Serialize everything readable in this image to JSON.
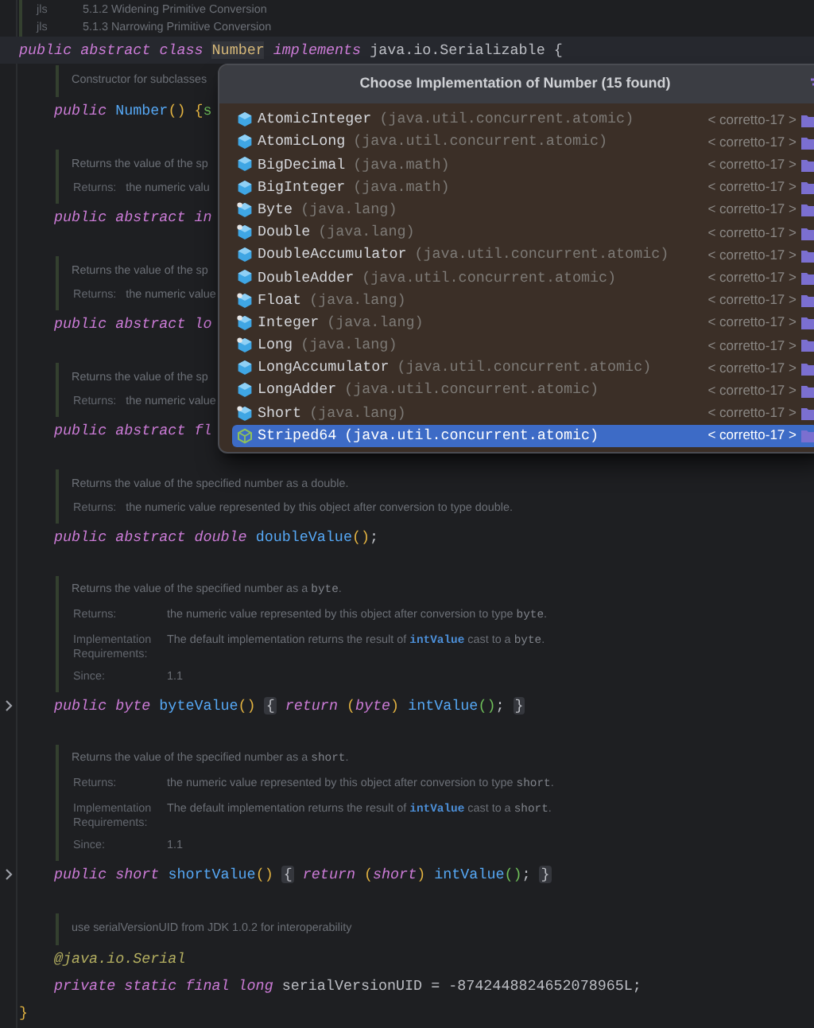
{
  "editor": {
    "class": {
      "doc": {
        "tags": [
          {
            "label": "jls",
            "text": [
              {
                "kind": "text",
                "text": "5.1.2 Widening Primitive Conversion"
              }
            ]
          },
          {
            "label": "jls",
            "text": [
              {
                "kind": "text",
                "text": "5.1.3 Narrowing Primitive Conversion"
              }
            ]
          }
        ]
      },
      "declaration": {
        "tokens": [
          {
            "kind": "keyword",
            "text": "public abstract class "
          },
          {
            "kind": "class_marked",
            "text": "Number"
          },
          {
            "kind": "keyword",
            "text": " implements "
          },
          {
            "kind": "plain",
            "text": "java.io.Serializable {"
          }
        ]
      },
      "members": [
        {
          "doc": {
            "summary": [
              {
                "kind": "text",
                "text": "Constructor for subclasses"
              }
            ]
          },
          "lines": [
            {
              "folded": false,
              "tokens": [
                {
                  "kind": "keyword",
                  "text": "public "
                },
                {
                  "kind": "method",
                  "text": "Number"
                },
                {
                  "kind": "bracket",
                  "text": "() {"
                },
                {
                  "kind": "bracket2",
                  "text": "s"
                }
              ]
            }
          ]
        },
        {
          "doc": {
            "summary": [
              {
                "kind": "text",
                "text": "Returns the value of the sp"
              }
            ],
            "tags": [
              {
                "label": "Returns:",
                "text": [
                  {
                    "kind": "text",
                    "text": "the numeric valu"
                  }
                ]
              }
            ]
          },
          "lines": [
            {
              "folded": false,
              "tokens": [
                {
                  "kind": "keyword",
                  "text": "public abstract in"
                }
              ]
            }
          ]
        },
        {
          "doc": {
            "summary": [
              {
                "kind": "text",
                "text": "Returns the value of the sp"
              }
            ],
            "tags": [
              {
                "label": "Returns:",
                "text": [
                  {
                    "kind": "text",
                    "text": "the numeric value"
                  }
                ]
              }
            ]
          },
          "lines": [
            {
              "folded": false,
              "tokens": [
                {
                  "kind": "keyword",
                  "text": "public abstract lo"
                }
              ]
            }
          ]
        },
        {
          "doc": {
            "summary": [
              {
                "kind": "text",
                "text": "Returns the value of the sp"
              }
            ],
            "tags": [
              {
                "label": "Returns:",
                "text": [
                  {
                    "kind": "text",
                    "text": "the numeric value"
                  }
                ]
              }
            ]
          },
          "lines": [
            {
              "folded": false,
              "tokens": [
                {
                  "kind": "keyword",
                  "text": "public abstract fl"
                }
              ]
            }
          ]
        },
        {
          "doc": {
            "summary": [
              {
                "kind": "text",
                "text": "Returns the value of the specified number as a double."
              }
            ],
            "tags": [
              {
                "label": "Returns:",
                "text": [
                  {
                    "kind": "text",
                    "text": "the numeric value represented by this object after conversion to type double."
                  }
                ]
              }
            ]
          },
          "lines": [
            {
              "folded": false,
              "tokens": [
                {
                  "kind": "keyword",
                  "text": "public abstract double "
                },
                {
                  "kind": "method",
                  "text": "doubleValue"
                },
                {
                  "kind": "bracket",
                  "text": "()"
                },
                {
                  "kind": "plain",
                  "text": ";"
                }
              ]
            }
          ]
        },
        {
          "doc": {
            "summary": [
              {
                "kind": "text",
                "text": "Returns the value of the specified number as a "
              },
              {
                "kind": "code",
                "text": "byte"
              },
              {
                "kind": "text",
                "text": "."
              }
            ],
            "tags": [
              {
                "label": "Returns:",
                "text": [
                  {
                    "kind": "text",
                    "text": "the numeric value represented by this object after conversion to type "
                  },
                  {
                    "kind": "code",
                    "text": "byte"
                  },
                  {
                    "kind": "text",
                    "text": "."
                  }
                ]
              },
              {
                "label": "Implementation Requirements:",
                "text": [
                  {
                    "kind": "text",
                    "text": "The default implementation returns the result of "
                  },
                  {
                    "kind": "link",
                    "text": "intValue"
                  },
                  {
                    "kind": "text",
                    "text": " cast to a "
                  },
                  {
                    "kind": "code",
                    "text": "byte"
                  },
                  {
                    "kind": "text",
                    "text": "."
                  }
                ]
              },
              {
                "label": "Since:",
                "text": [
                  {
                    "kind": "text",
                    "text": "1.1"
                  }
                ]
              }
            ]
          },
          "lines": [
            {
              "folded": true,
              "tokens": [
                {
                  "kind": "keyword",
                  "text": "public byte "
                },
                {
                  "kind": "method",
                  "text": "byteValue"
                },
                {
                  "kind": "bracket",
                  "text": "() "
                },
                {
                  "kind": "fold",
                  "text": "{"
                },
                {
                  "kind": "keyword",
                  "text": " return "
                },
                {
                  "kind": "bracket",
                  "text": "("
                },
                {
                  "kind": "keyword",
                  "text": "byte"
                },
                {
                  "kind": "bracket",
                  "text": ") "
                },
                {
                  "kind": "method",
                  "text": "intValue"
                },
                {
                  "kind": "bracket2",
                  "text": "()"
                },
                {
                  "kind": "plain",
                  "text": "; "
                },
                {
                  "kind": "fold",
                  "text": "}"
                }
              ]
            }
          ]
        },
        {
          "doc": {
            "summary": [
              {
                "kind": "text",
                "text": "Returns the value of the specified number as a "
              },
              {
                "kind": "code",
                "text": "short"
              },
              {
                "kind": "text",
                "text": "."
              }
            ],
            "tags": [
              {
                "label": "Returns:",
                "text": [
                  {
                    "kind": "text",
                    "text": "the numeric value represented by this object after conversion to type "
                  },
                  {
                    "kind": "code",
                    "text": "short"
                  },
                  {
                    "kind": "text",
                    "text": "."
                  }
                ]
              },
              {
                "label": "Implementation Requirements:",
                "text": [
                  {
                    "kind": "text",
                    "text": "The default implementation returns the result of "
                  },
                  {
                    "kind": "link",
                    "text": "intValue"
                  },
                  {
                    "kind": "text",
                    "text": " cast to a "
                  },
                  {
                    "kind": "code",
                    "text": "short"
                  },
                  {
                    "kind": "text",
                    "text": "."
                  }
                ]
              },
              {
                "label": "Since:",
                "text": [
                  {
                    "kind": "text",
                    "text": "1.1"
                  }
                ]
              }
            ]
          },
          "lines": [
            {
              "folded": true,
              "tokens": [
                {
                  "kind": "keyword",
                  "text": "public short "
                },
                {
                  "kind": "method",
                  "text": "shortValue"
                },
                {
                  "kind": "bracket",
                  "text": "() "
                },
                {
                  "kind": "fold",
                  "text": "{"
                },
                {
                  "kind": "keyword",
                  "text": " return "
                },
                {
                  "kind": "bracket",
                  "text": "("
                },
                {
                  "kind": "keyword",
                  "text": "short"
                },
                {
                  "kind": "bracket",
                  "text": ") "
                },
                {
                  "kind": "method",
                  "text": "intValue"
                },
                {
                  "kind": "bracket2",
                  "text": "()"
                },
                {
                  "kind": "plain",
                  "text": "; "
                },
                {
                  "kind": "fold",
                  "text": "}"
                }
              ]
            }
          ]
        },
        {
          "doc": {
            "summary": [
              {
                "kind": "text",
                "text": "use serialVersionUID from JDK 1.0.2 for interoperability"
              }
            ]
          },
          "lines": [
            {
              "folded": false,
              "tokens": [
                {
                  "kind": "annotation",
                  "text": "@java.io.Serial"
                }
              ]
            },
            {
              "folded": false,
              "tokens": [
                {
                  "kind": "keyword",
                  "text": "private static final long "
                },
                {
                  "kind": "plain",
                  "text": "serialVersionUID = -8742448824652078965L;"
                }
              ]
            }
          ]
        }
      ],
      "closing": {
        "tokens": [
          {
            "kind": "bracket",
            "text": "}"
          }
        ]
      }
    }
  },
  "popup": {
    "title": "Choose Implementation of Number (15 found)",
    "items": [
      {
        "name": "AtomicInteger",
        "package": "(java.util.concurrent.atomic)",
        "module": "< corretto-17 >",
        "kind": "class",
        "selected": false
      },
      {
        "name": "AtomicLong",
        "package": "(java.util.concurrent.atomic)",
        "module": "< corretto-17 >",
        "kind": "class",
        "selected": false
      },
      {
        "name": "BigDecimal",
        "package": "(java.math)",
        "module": "< corretto-17 >",
        "kind": "class",
        "selected": false
      },
      {
        "name": "BigInteger",
        "package": "(java.math)",
        "module": "< corretto-17 >",
        "kind": "class",
        "selected": false
      },
      {
        "name": "Byte",
        "package": "(java.lang)",
        "module": "< corretto-17 >",
        "kind": "final_class",
        "selected": false
      },
      {
        "name": "Double",
        "package": "(java.lang)",
        "module": "< corretto-17 >",
        "kind": "final_class",
        "selected": false
      },
      {
        "name": "DoubleAccumulator",
        "package": "(java.util.concurrent.atomic)",
        "module": "< corretto-17 >",
        "kind": "class",
        "selected": false
      },
      {
        "name": "DoubleAdder",
        "package": "(java.util.concurrent.atomic)",
        "module": "< corretto-17 >",
        "kind": "class",
        "selected": false
      },
      {
        "name": "Float",
        "package": "(java.lang)",
        "module": "< corretto-17 >",
        "kind": "final_class",
        "selected": false
      },
      {
        "name": "Integer",
        "package": "(java.lang)",
        "module": "< corretto-17 >",
        "kind": "final_class",
        "selected": false
      },
      {
        "name": "Long",
        "package": "(java.lang)",
        "module": "< corretto-17 >",
        "kind": "final_class",
        "selected": false
      },
      {
        "name": "LongAccumulator",
        "package": "(java.util.concurrent.atomic)",
        "module": "< corretto-17 >",
        "kind": "class",
        "selected": false
      },
      {
        "name": "LongAdder",
        "package": "(java.util.concurrent.atomic)",
        "module": "< corretto-17 >",
        "kind": "class",
        "selected": false
      },
      {
        "name": "Short",
        "package": "(java.lang)",
        "module": "< corretto-17 >",
        "kind": "final_class",
        "selected": false
      },
      {
        "name": "Striped64",
        "package": "(java.util.concurrent.atomic)",
        "module": "< corretto-17 >",
        "kind": "abstract_class",
        "selected": true
      }
    ]
  }
}
